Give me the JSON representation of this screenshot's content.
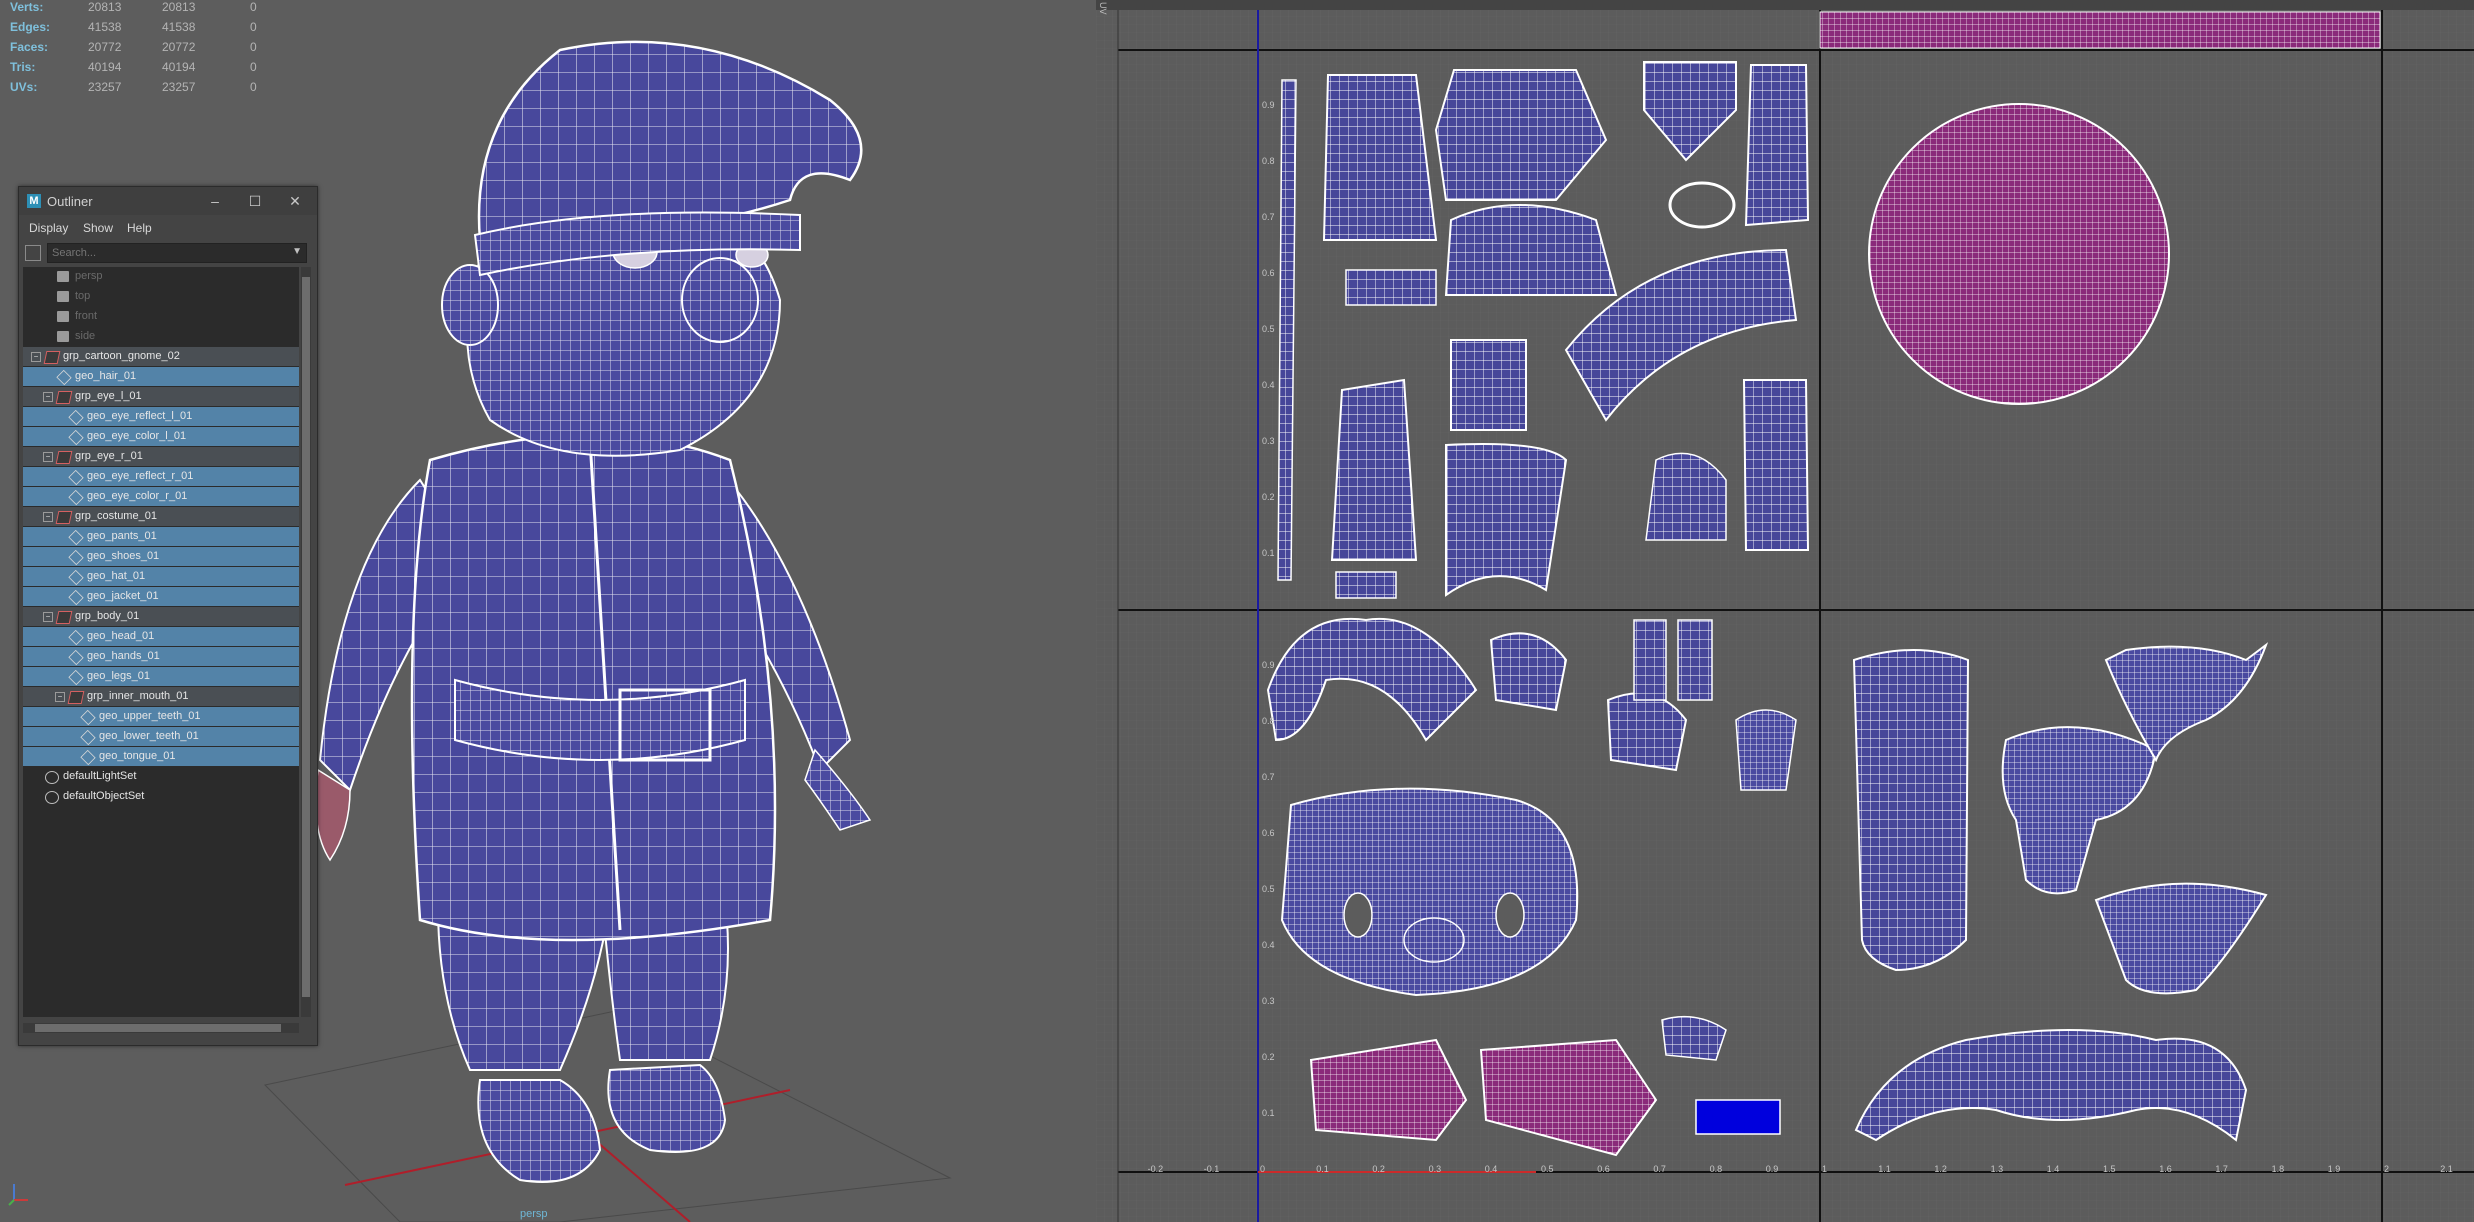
{
  "hud": {
    "rows": [
      {
        "label": "Verts:",
        "a": "20813",
        "b": "20813",
        "c": "0"
      },
      {
        "label": "Edges:",
        "a": "41538",
        "b": "41538",
        "c": "0"
      },
      {
        "label": "Faces:",
        "a": "20772",
        "b": "20772",
        "c": "0"
      },
      {
        "label": "Tris:",
        "a": "40194",
        "b": "40194",
        "c": "0"
      },
      {
        "label": "UVs:",
        "a": "23257",
        "b": "23257",
        "c": "0"
      }
    ]
  },
  "viewport": {
    "camera_label": "persp"
  },
  "outliner": {
    "title": "Outliner",
    "menus": [
      "Display",
      "Show",
      "Help"
    ],
    "search_placeholder": "Search...",
    "items": [
      {
        "label": "persp",
        "kind": "camera",
        "indent": 1
      },
      {
        "label": "top",
        "kind": "camera",
        "indent": 1
      },
      {
        "label": "front",
        "kind": "camera",
        "indent": 1
      },
      {
        "label": "side",
        "kind": "camera",
        "indent": 1
      },
      {
        "label": "grp_cartoon_gnome_02",
        "kind": "group",
        "indent": 0
      },
      {
        "label": "geo_hair_01",
        "kind": "mesh",
        "indent": 1
      },
      {
        "label": "grp_eye_l_01",
        "kind": "group",
        "indent": 1
      },
      {
        "label": "geo_eye_reflect_l_01",
        "kind": "mesh",
        "indent": 2
      },
      {
        "label": "geo_eye_color_l_01",
        "kind": "mesh",
        "indent": 2
      },
      {
        "label": "grp_eye_r_01",
        "kind": "group",
        "indent": 1
      },
      {
        "label": "geo_eye_reflect_r_01",
        "kind": "mesh",
        "indent": 2
      },
      {
        "label": "geo_eye_color_r_01",
        "kind": "mesh",
        "indent": 2
      },
      {
        "label": "grp_costume_01",
        "kind": "group",
        "indent": 1
      },
      {
        "label": "geo_pants_01",
        "kind": "mesh",
        "indent": 2
      },
      {
        "label": "geo_shoes_01",
        "kind": "mesh",
        "indent": 2
      },
      {
        "label": "geo_hat_01",
        "kind": "mesh",
        "indent": 2
      },
      {
        "label": "geo_jacket_01",
        "kind": "mesh",
        "indent": 2
      },
      {
        "label": "grp_body_01",
        "kind": "group",
        "indent": 1
      },
      {
        "label": "geo_head_01",
        "kind": "mesh",
        "indent": 2
      },
      {
        "label": "geo_hands_01",
        "kind": "mesh",
        "indent": 2
      },
      {
        "label": "geo_legs_01",
        "kind": "mesh",
        "indent": 2
      },
      {
        "label": "grp_inner_mouth_01",
        "kind": "group",
        "indent": 2
      },
      {
        "label": "geo_upper_teeth_01",
        "kind": "mesh",
        "indent": 3
      },
      {
        "label": "geo_lower_teeth_01",
        "kind": "mesh",
        "indent": 3
      },
      {
        "label": "geo_tongue_01",
        "kind": "mesh",
        "indent": 3
      },
      {
        "label": "defaultLightSet",
        "kind": "set",
        "indent": 0
      },
      {
        "label": "defaultObjectSet",
        "kind": "set",
        "indent": 0
      }
    ]
  },
  "uv_editor": {
    "panel_label": "UV",
    "u_ticks": [
      "-0.2",
      "-0.1",
      "0",
      "0.1",
      "0.2",
      "0.3",
      "0.4",
      "0.5",
      "0.6",
      "0.7",
      "0.8",
      "0.9",
      "1",
      "1.1",
      "1.2",
      "1.3",
      "1.4",
      "1.5",
      "1.6",
      "1.7",
      "1.8",
      "1.9",
      "2",
      "2.1"
    ],
    "v_ticks_top": [
      "0.9",
      "0.8",
      "0.7",
      "0.6",
      "0.5",
      "0.4",
      "0.3",
      "0.2",
      "0.1"
    ],
    "v_ticks_bottom": [
      "0.9",
      "0.8",
      "0.7",
      "0.6",
      "0.5",
      "0.4",
      "0.3",
      "0.2",
      "0.1"
    ]
  },
  "colors": {
    "mesh_fill": "#46469a",
    "wire": "#ffffff",
    "magenta_shell": "#8a2a7a",
    "hud_label": "#7fc0dc",
    "selection": "#5383a8",
    "axis_red": "#cc2a2a"
  }
}
